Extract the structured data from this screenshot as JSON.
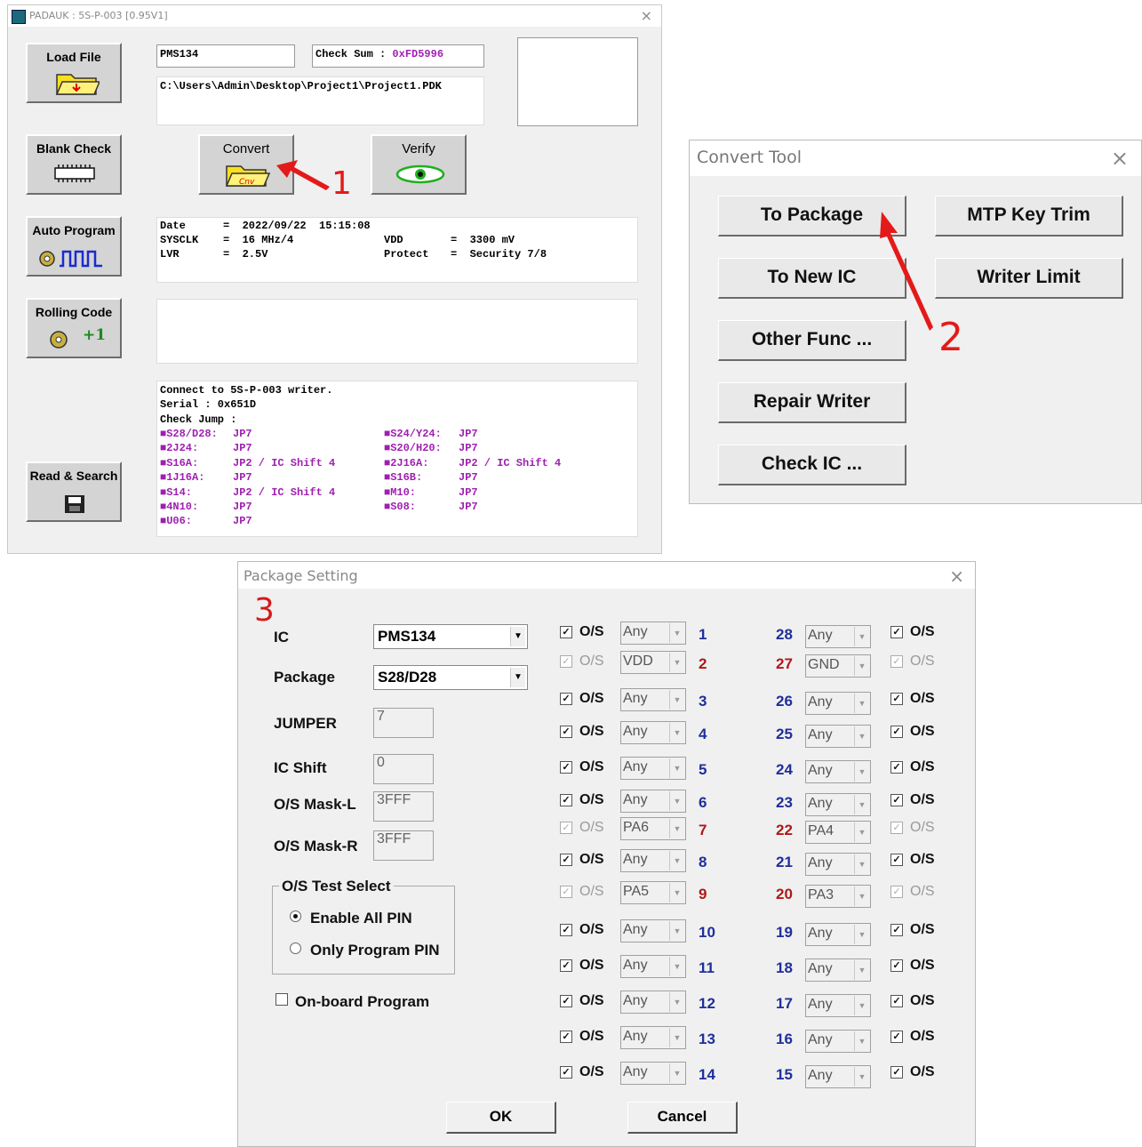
{
  "writer_window": {
    "title": "PADAUK : 5S-P-003 [0.95V1]",
    "buttons": {
      "load_file": "Load File",
      "blank_check": "Blank Check",
      "auto_program": "Auto Program",
      "rolling_code": "Rolling Code",
      "rolling_plus": "+1",
      "read_search": "Read & Search",
      "convert": "Convert",
      "verify": "Verify"
    },
    "ic_name": "PMS134",
    "checksum_label": "Check Sum : ",
    "checksum_value": "0xFD5996",
    "file_path": "C:\\Users\\Admin\\Desktop\\Project1\\Project1.PDK",
    "info": {
      "date_key": "Date",
      "date_val": "=  2022/09/22  15:15:08",
      "sysclk_key": "SYSCLK",
      "sysclk_val": "=  16 MHz/4",
      "lvr_key": "LVR",
      "lvr_val": "=  2.5V",
      "vdd_key": "VDD",
      "vdd_val": "=  3300 mV",
      "protect_key": "Protect",
      "protect_val": "=  Security 7/8"
    },
    "log": {
      "line1": "Connect to 5S-P-003 writer.",
      "line2": "Serial : 0x651D",
      "line3": "Check Jump :",
      "jumps_left": [
        {
          "pkg": "■S28/D28:",
          "jp": "JP7"
        },
        {
          "pkg": "■2J24:",
          "jp": "JP7"
        },
        {
          "pkg": "■S16A:",
          "jp": "JP2 / IC Shift 4"
        },
        {
          "pkg": "■1J16A:",
          "jp": "JP7"
        },
        {
          "pkg": "■S14:",
          "jp": "JP2 / IC Shift 4"
        },
        {
          "pkg": "■4N10:",
          "jp": "JP7"
        },
        {
          "pkg": "■U06:",
          "jp": "JP7"
        }
      ],
      "jumps_right": [
        {
          "pkg": "■S24/Y24:",
          "jp": "JP7"
        },
        {
          "pkg": "■S20/H20:",
          "jp": "JP7"
        },
        {
          "pkg": "■2J16A:",
          "jp": "JP2 / IC Shift 4"
        },
        {
          "pkg": "■S16B:",
          "jp": "JP7"
        },
        {
          "pkg": "■M10:",
          "jp": "JP7"
        },
        {
          "pkg": "■S08:",
          "jp": "JP7"
        }
      ]
    },
    "step_marker": "1"
  },
  "convert_tool": {
    "title": "Convert Tool",
    "buttons": {
      "to_package": "To Package",
      "mtp_key_trim": "MTP Key Trim",
      "to_new_ic": "To New IC",
      "writer_limit": "Writer Limit",
      "other_func": "Other Func ...",
      "repair_writer": "Repair Writer",
      "check_ic": "Check IC ..."
    },
    "step_marker": "2"
  },
  "package_setting": {
    "title": "Package Setting",
    "step_marker": "3",
    "labels": {
      "ic": "IC",
      "package": "Package",
      "jumper": "JUMPER",
      "ic_shift": "IC Shift",
      "os_mask_l": "O/S Mask-L",
      "os_mask_r": "O/S Mask-R"
    },
    "values": {
      "ic": "PMS134",
      "package": "S28/D28",
      "jumper": "7",
      "ic_shift": "0",
      "os_mask_l": "3FFF",
      "os_mask_r": "3FFF"
    },
    "os_test_group": "O/S Test Select",
    "radio_enable_all": "Enable All PIN",
    "radio_only_program": "Only Program PIN",
    "onboard_program": "On-board Program",
    "os_label": "O/S",
    "left_pins": [
      {
        "num": "1",
        "val": "Any"
      },
      {
        "num": "2",
        "val": "VDD"
      },
      {
        "num": "3",
        "val": "Any"
      },
      {
        "num": "4",
        "val": "Any"
      },
      {
        "num": "5",
        "val": "Any"
      },
      {
        "num": "6",
        "val": "Any"
      },
      {
        "num": "7",
        "val": "PA6"
      },
      {
        "num": "8",
        "val": "Any"
      },
      {
        "num": "9",
        "val": "PA5"
      },
      {
        "num": "10",
        "val": "Any"
      },
      {
        "num": "11",
        "val": "Any"
      },
      {
        "num": "12",
        "val": "Any"
      },
      {
        "num": "13",
        "val": "Any"
      },
      {
        "num": "14",
        "val": "Any"
      }
    ],
    "right_pins": [
      {
        "num": "28",
        "val": "Any"
      },
      {
        "num": "27",
        "val": "GND"
      },
      {
        "num": "26",
        "val": "Any"
      },
      {
        "num": "25",
        "val": "Any"
      },
      {
        "num": "24",
        "val": "Any"
      },
      {
        "num": "23",
        "val": "Any"
      },
      {
        "num": "22",
        "val": "PA4"
      },
      {
        "num": "21",
        "val": "Any"
      },
      {
        "num": "20",
        "val": "PA3"
      },
      {
        "num": "19",
        "val": "Any"
      },
      {
        "num": "18",
        "val": "Any"
      },
      {
        "num": "17",
        "val": "Any"
      },
      {
        "num": "16",
        "val": "Any"
      },
      {
        "num": "15",
        "val": "Any"
      }
    ],
    "ok": "OK",
    "cancel": "Cancel"
  },
  "colors": {
    "accent_red": "#e41a1a",
    "pin_blue": "#1f2f9a",
    "pin_red": "#b01818",
    "log_magenta": "#9f1fb0"
  }
}
